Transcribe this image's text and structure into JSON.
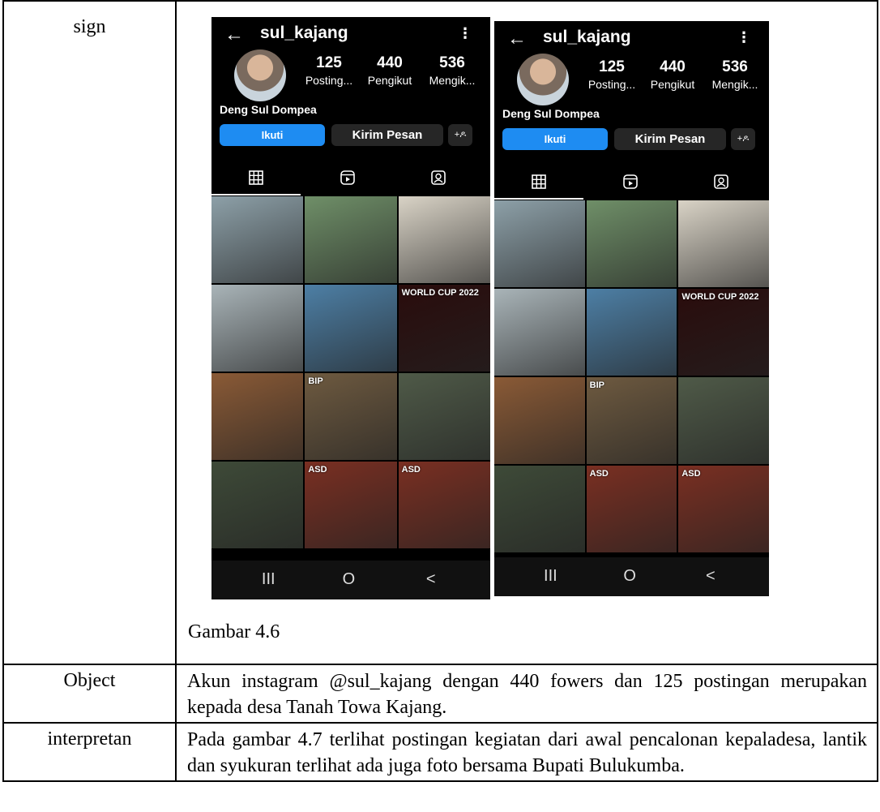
{
  "rows": {
    "sign_label": "sign",
    "caption": "Gambar 4.6",
    "object_label": "Object",
    "object_text": "Akun instagram @sul_kajang dengan 440 fowers dan 125 postingan merupakan kepada desa Tanah Towa Kajang.",
    "interp_label": "interpretan",
    "interp_text": "Pada gambar 4.7 terlihat postingan kegiatan dari awal pencalonan kepaladesa, lantik dan syukuran terlihat ada juga foto bersama Bupati Bulukumba."
  },
  "profile": {
    "username": "sul_kajang",
    "display_name": "Deng Sul Dompea",
    "posts_count": "125",
    "posts_label": "Posting...",
    "followers_count": "440",
    "followers_label": "Pengikut",
    "following_count": "536",
    "following_label": "Mengik...",
    "follow_button": "Ikuti",
    "message_button": "Kirim Pesan",
    "back_glyph": "←",
    "more_glyph": "⋮",
    "add_person_glyph": "+ዶ"
  },
  "grid_tiles": [
    {
      "caption": "",
      "color": "#8da0a8"
    },
    {
      "caption": "",
      "color": "#6f8f68"
    },
    {
      "caption": "",
      "color": "#d9d3c6"
    },
    {
      "caption": "",
      "color": "#a9b4b8"
    },
    {
      "caption": "",
      "color": "#4d7fa5"
    },
    {
      "caption": "WORLD CUP 2022",
      "color": "#2a0c0c"
    },
    {
      "caption": "",
      "color": "#8a5a36"
    },
    {
      "caption": "BIP",
      "color": "#6e5a40"
    },
    {
      "caption": "",
      "color": "#4f5a48"
    },
    {
      "caption": "",
      "color": "#3e4a38"
    },
    {
      "caption": "ASD",
      "color": "#7a2f22"
    },
    {
      "caption": "ASD",
      "color": "#7a2f22"
    }
  ],
  "navbar": {
    "recent": "III",
    "home": "O",
    "back": "<"
  }
}
